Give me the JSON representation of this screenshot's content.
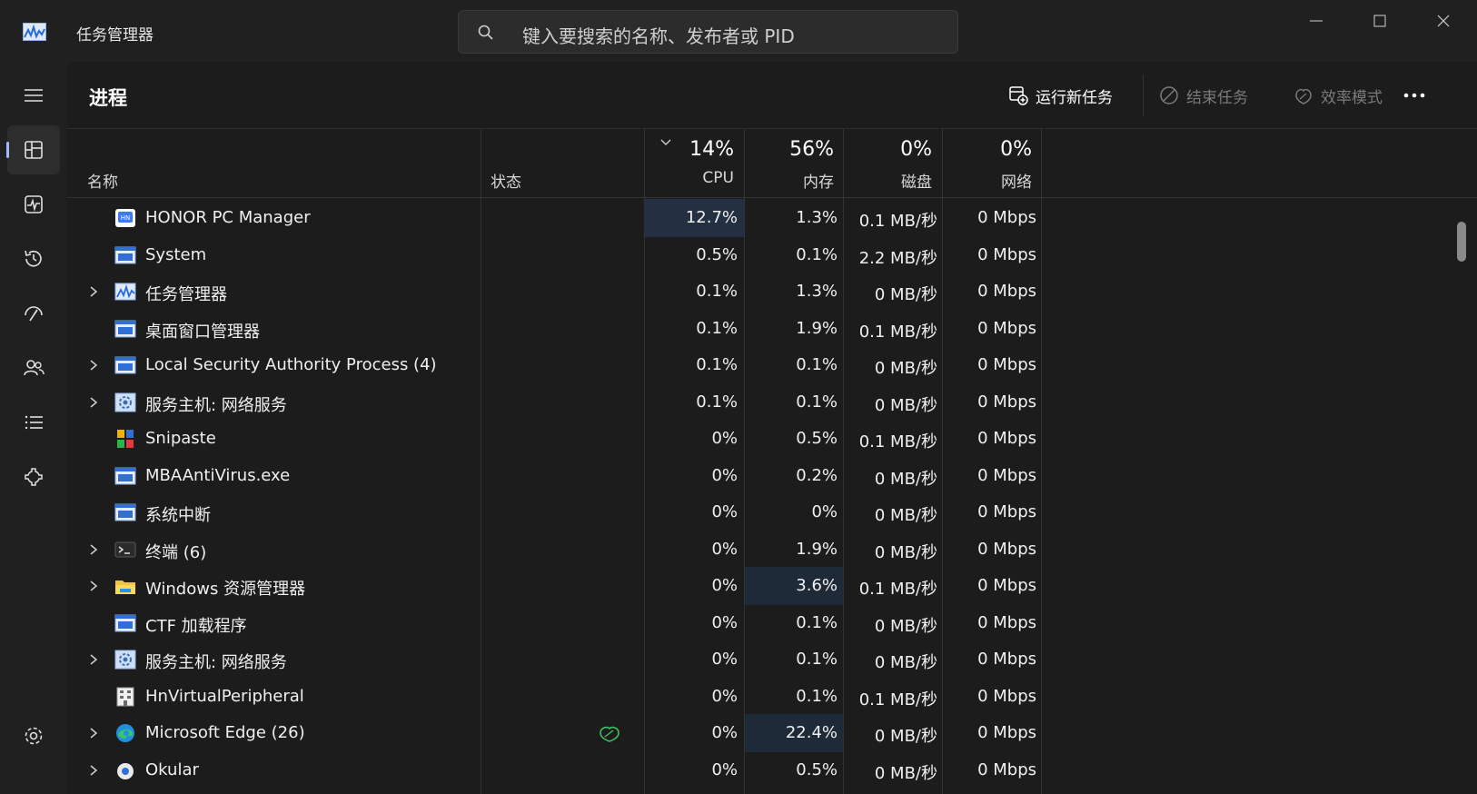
{
  "window": {
    "title": "任务管理器",
    "search_placeholder": "键入要搜索的名称、发布者或 PID",
    "controls": [
      "minimize-icon",
      "maximize-icon",
      "close-icon"
    ]
  },
  "sidebar": {
    "items": [
      {
        "name": "menu",
        "icon": "hamburger-icon"
      },
      {
        "name": "processes",
        "icon": "processes-icon",
        "active": true
      },
      {
        "name": "performance",
        "icon": "performance-icon"
      },
      {
        "name": "app-history",
        "icon": "history-icon"
      },
      {
        "name": "startup",
        "icon": "startup-icon"
      },
      {
        "name": "users",
        "icon": "users-icon"
      },
      {
        "name": "details",
        "icon": "details-icon"
      },
      {
        "name": "services",
        "icon": "services-icon"
      },
      {
        "name": "settings",
        "icon": "settings-icon"
      }
    ]
  },
  "toolbar": {
    "title": "进程",
    "run_new_task": "运行新任务",
    "end_task": "结束任务",
    "efficiency_mode": "效率模式",
    "more": "more-icon"
  },
  "table": {
    "headers": {
      "name": "名称",
      "status": "状态",
      "cpu_pct": "14%",
      "cpu": "CPU",
      "mem_pct": "56%",
      "mem": "内存",
      "disk_pct": "0%",
      "disk": "磁盘",
      "net_pct": "0%",
      "net": "网络"
    },
    "rows": [
      {
        "name": "HONOR PC Manager",
        "icon": "honor-icon",
        "expandable": false,
        "status": "",
        "cpu": "12.7%",
        "mem": "1.3%",
        "disk": "0.1 MB/秒",
        "net": "0 Mbps",
        "cpu_heat": 1,
        "mem_heat": 0
      },
      {
        "name": "System",
        "icon": "window-icon",
        "expandable": false,
        "status": "",
        "cpu": "0.5%",
        "mem": "0.1%",
        "disk": "2.2 MB/秒",
        "net": "0 Mbps",
        "cpu_heat": 0,
        "mem_heat": 0
      },
      {
        "name": "任务管理器",
        "icon": "taskmgr-icon",
        "expandable": true,
        "status": "",
        "cpu": "0.1%",
        "mem": "1.3%",
        "disk": "0 MB/秒",
        "net": "0 Mbps",
        "cpu_heat": 0,
        "mem_heat": 0
      },
      {
        "name": "桌面窗口管理器",
        "icon": "window-icon",
        "expandable": false,
        "status": "",
        "cpu": "0.1%",
        "mem": "1.9%",
        "disk": "0.1 MB/秒",
        "net": "0 Mbps",
        "cpu_heat": 0,
        "mem_heat": 0
      },
      {
        "name": "Local Security Authority Process (4)",
        "icon": "window-icon",
        "expandable": true,
        "status": "",
        "cpu": "0.1%",
        "mem": "0.1%",
        "disk": "0 MB/秒",
        "net": "0 Mbps",
        "cpu_heat": 0,
        "mem_heat": 0
      },
      {
        "name": "服务主机: 网络服务",
        "icon": "gear-service-icon",
        "expandable": true,
        "status": "",
        "cpu": "0.1%",
        "mem": "0.1%",
        "disk": "0 MB/秒",
        "net": "0 Mbps",
        "cpu_heat": 0,
        "mem_heat": 0
      },
      {
        "name": "Snipaste",
        "icon": "snipaste-icon",
        "expandable": false,
        "status": "",
        "cpu": "0%",
        "mem": "0.5%",
        "disk": "0.1 MB/秒",
        "net": "0 Mbps",
        "cpu_heat": 0,
        "mem_heat": 0
      },
      {
        "name": "MBAAntiVirus.exe",
        "icon": "window-icon",
        "expandable": false,
        "status": "",
        "cpu": "0%",
        "mem": "0.2%",
        "disk": "0 MB/秒",
        "net": "0 Mbps",
        "cpu_heat": 0,
        "mem_heat": 0
      },
      {
        "name": "系统中断",
        "icon": "window-icon",
        "expandable": false,
        "status": "",
        "cpu": "0%",
        "mem": "0%",
        "disk": "0 MB/秒",
        "net": "0 Mbps",
        "cpu_heat": 0,
        "mem_heat": 0
      },
      {
        "name": "终端 (6)",
        "icon": "terminal-icon",
        "expandable": true,
        "status": "",
        "cpu": "0%",
        "mem": "1.9%",
        "disk": "0 MB/秒",
        "net": "0 Mbps",
        "cpu_heat": 0,
        "mem_heat": 0
      },
      {
        "name": "Windows 资源管理器",
        "icon": "folder-icon",
        "expandable": true,
        "status": "",
        "cpu": "0%",
        "mem": "3.6%",
        "disk": "0.1 MB/秒",
        "net": "0 Mbps",
        "cpu_heat": 0,
        "mem_heat": 2
      },
      {
        "name": "CTF 加载程序",
        "icon": "window-icon",
        "expandable": false,
        "status": "",
        "cpu": "0%",
        "mem": "0.1%",
        "disk": "0 MB/秒",
        "net": "0 Mbps",
        "cpu_heat": 0,
        "mem_heat": 0
      },
      {
        "name": "服务主机: 网络服务",
        "icon": "gear-service-icon",
        "expandable": true,
        "status": "",
        "cpu": "0%",
        "mem": "0.1%",
        "disk": "0 MB/秒",
        "net": "0 Mbps",
        "cpu_heat": 0,
        "mem_heat": 0
      },
      {
        "name": "HnVirtualPeripheral",
        "icon": "building-icon",
        "expandable": false,
        "status": "",
        "cpu": "0%",
        "mem": "0.1%",
        "disk": "0.1 MB/秒",
        "net": "0 Mbps",
        "cpu_heat": 0,
        "mem_heat": 0
      },
      {
        "name": "Microsoft Edge (26)",
        "icon": "edge-icon",
        "expandable": true,
        "status": "leaf-icon",
        "cpu": "0%",
        "mem": "22.4%",
        "disk": "0 MB/秒",
        "net": "0 Mbps",
        "cpu_heat": 0,
        "mem_heat": 2
      },
      {
        "name": "Okular",
        "icon": "okular-icon",
        "expandable": true,
        "status": "",
        "cpu": "0%",
        "mem": "0.5%",
        "disk": "0 MB/秒",
        "net": "0 Mbps",
        "cpu_heat": 0,
        "mem_heat": 0
      }
    ]
  },
  "colors": {
    "background": "#202020",
    "panel": "#1c1c1c",
    "accent": "#9fb8ff",
    "heat_high": "#233042",
    "heat_mid": "#1f2a38",
    "efficiency_green": "#3fbf5f"
  }
}
